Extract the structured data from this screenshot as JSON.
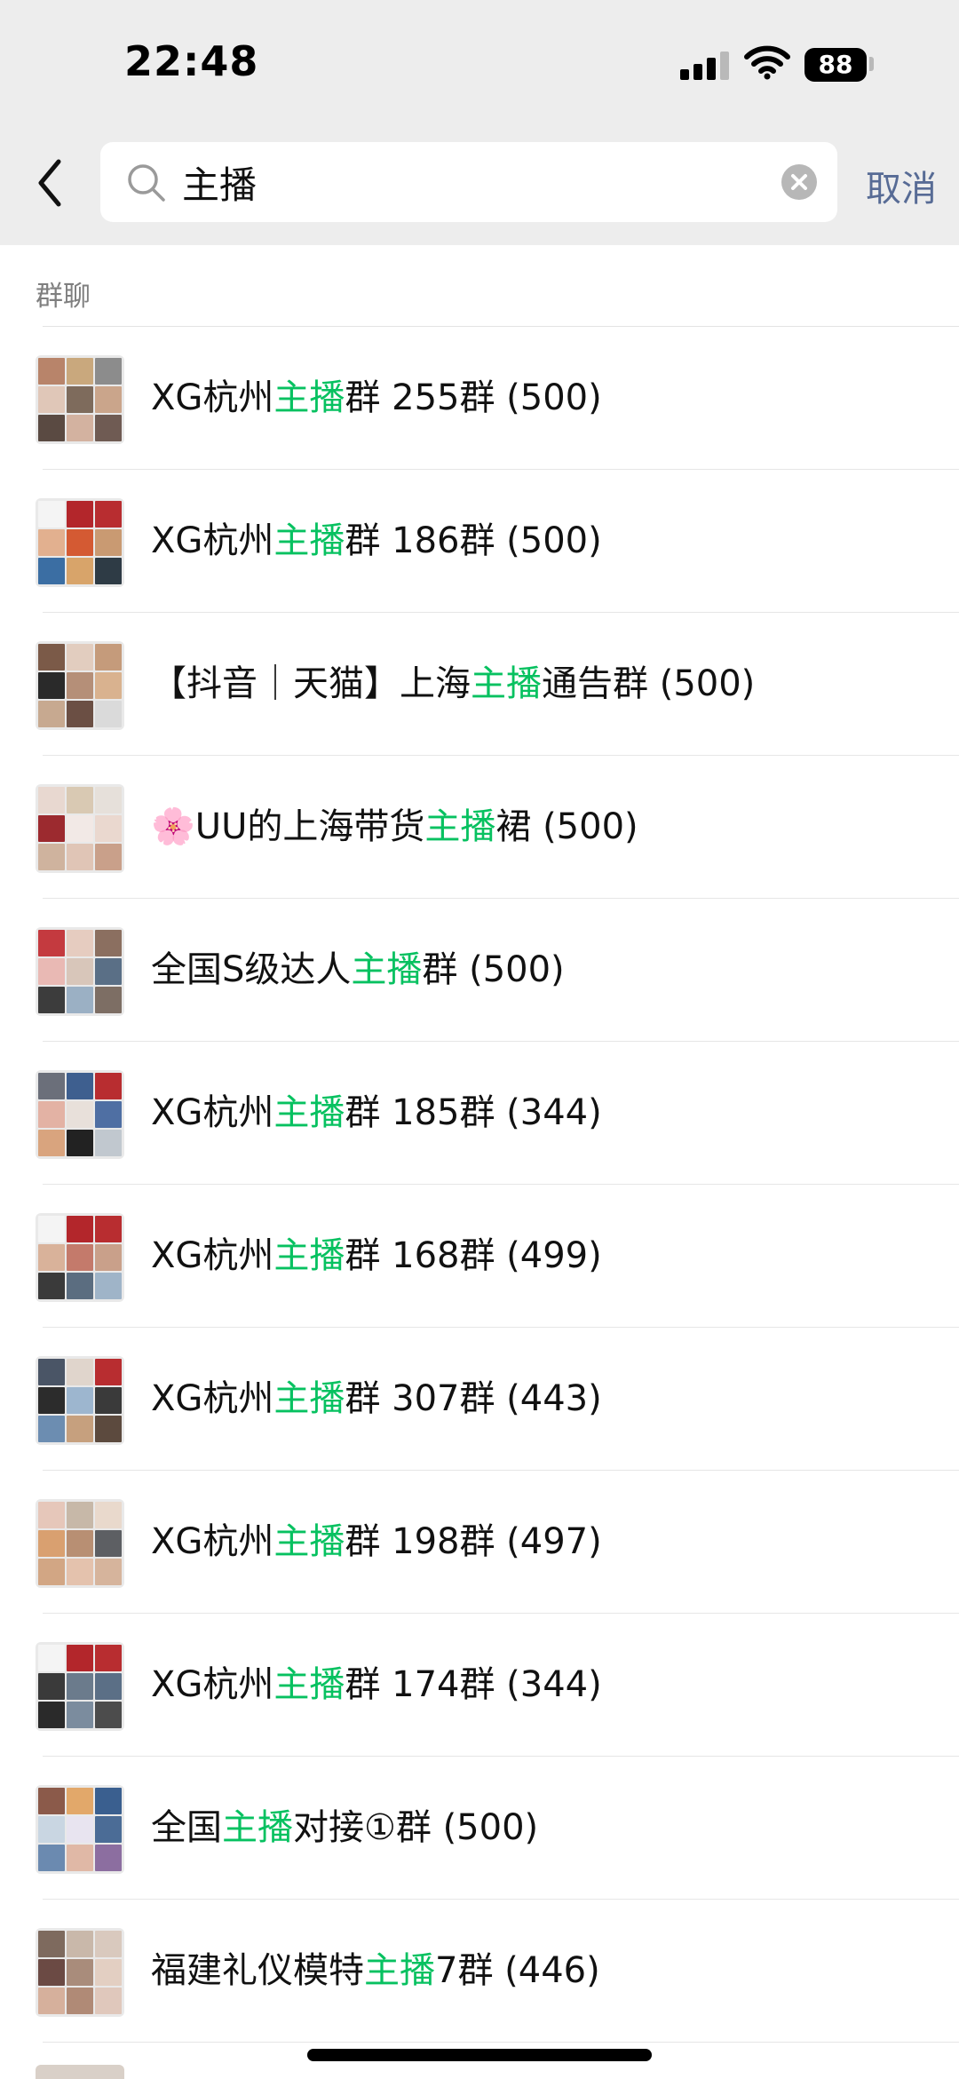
{
  "status_bar": {
    "time": "22:48",
    "battery": "88"
  },
  "search": {
    "query": "主播",
    "cancel_label": "取消"
  },
  "section": {
    "title": "群聊"
  },
  "results": [
    {
      "before": "XG杭州",
      "highlight": "主播",
      "after": "群 255群 (500)",
      "avatar": [
        "#b8846a",
        "#c9a87d",
        "#8c8c8c",
        "#e0c7b8",
        "#7e6b5c",
        "#caa58b",
        "#5a4a42",
        "#d3b2a0",
        "#6f5b53"
      ]
    },
    {
      "before": "XG杭州",
      "highlight": "主播",
      "after": "群 186群 (500)",
      "avatar": [
        "#f4f4f4",
        "#b3262b",
        "#b82d30",
        "#e2b08f",
        "#d45a33",
        "#c99a72",
        "#3b6ea3",
        "#d8a46a",
        "#2e3b45"
      ]
    },
    {
      "before": "【抖音｜天猫】上海",
      "highlight": "主播",
      "after": "通告群 (500)",
      "avatar": [
        "#7b5a48",
        "#e2cdbf",
        "#c59b7b",
        "#2a2a2a",
        "#b58f78",
        "#d9b28f",
        "#c7a990",
        "#6b4f44",
        "#dadada"
      ]
    },
    {
      "before": "🌸UU的上海带货",
      "highlight": "主播",
      "after": "裙 (500)",
      "avatar": [
        "#e8d8d0",
        "#d9c9b3",
        "#e6e0da",
        "#9c2a2f",
        "#f2e9e6",
        "#ead8cf",
        "#cfb39e",
        "#e0c5b6",
        "#c9a08a"
      ]
    },
    {
      "before": "全国S级达人",
      "highlight": "主播",
      "after": "群 (500)",
      "avatar": [
        "#c43a3f",
        "#e6ccc0",
        "#8b6f60",
        "#e9b9b4",
        "#d8c6ba",
        "#5a6f86",
        "#3c3c3c",
        "#9bb0c4",
        "#7d6e64"
      ]
    },
    {
      "before": "XG杭州",
      "highlight": "主播",
      "after": "群 185群 (344)",
      "avatar": [
        "#6b6f7a",
        "#3e5f8f",
        "#b82d30",
        "#e3b2a4",
        "#e8e0da",
        "#4f6fa3",
        "#d9a47e",
        "#222222",
        "#c1c8cf"
      ]
    },
    {
      "before": "XG杭州",
      "highlight": "主播",
      "after": "群 168群 (499)",
      "avatar": [
        "#f4f4f4",
        "#b3262b",
        "#b82d30",
        "#d9b29a",
        "#c47a6b",
        "#c9a08a",
        "#3a3a3a",
        "#5b6d80",
        "#9fb4c8"
      ]
    },
    {
      "before": "XG杭州",
      "highlight": "主播",
      "after": "群 307群 (443)",
      "avatar": [
        "#4a5566",
        "#e0d5cc",
        "#b82d30",
        "#2c2c2c",
        "#9db6cf",
        "#3a3a3a",
        "#6c8db1",
        "#c6a07e",
        "#5c4a3e"
      ]
    },
    {
      "before": "XG杭州",
      "highlight": "主播",
      "after": "群 198群 (497)",
      "avatar": [
        "#e6c7ba",
        "#c7b8a8",
        "#e9d9cc",
        "#d9a070",
        "#b88f73",
        "#5d5f63",
        "#d2a684",
        "#e4c2ad",
        "#d6b49c"
      ]
    },
    {
      "before": "XG杭州",
      "highlight": "主播",
      "after": "群 174群 (344)",
      "avatar": [
        "#f4f4f4",
        "#b3262b",
        "#b82d30",
        "#3a3a3a",
        "#6b7b8c",
        "#5b6f86",
        "#2a2a2a",
        "#7b8c9e",
        "#4c4c4c"
      ]
    },
    {
      "before": "全国",
      "highlight": "主播",
      "after": "对接①群 (500)",
      "avatar": [
        "#8b5a4a",
        "#e2a86a",
        "#3a5f8f",
        "#c9d6e2",
        "#e8e4f0",
        "#4b6c96",
        "#6b8ab0",
        "#e0b8a6",
        "#8c6ea0"
      ]
    },
    {
      "before": "福建礼仪模特",
      "highlight": "主播",
      "after": "7群 (446)",
      "avatar": [
        "#7e6a5e",
        "#c9b8aa",
        "#d9c9be",
        "#6b4a44",
        "#a98c7b",
        "#e3cfc2",
        "#d6b09c",
        "#b08a76",
        "#e0c8bc"
      ]
    }
  ]
}
